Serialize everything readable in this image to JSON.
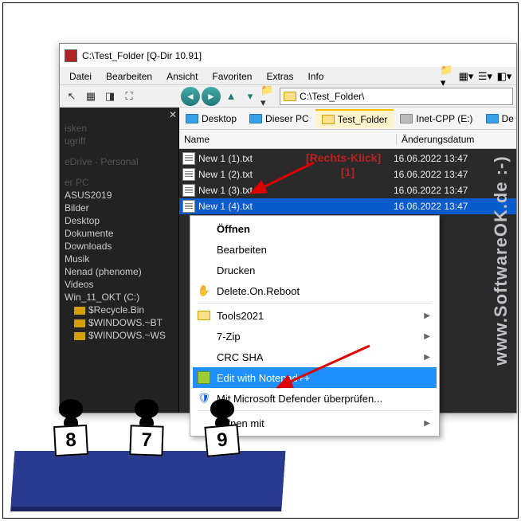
{
  "window": {
    "title": "C:\\Test_Folder  [Q-Dir 10.91]",
    "menu": [
      "Datei",
      "Bearbeiten",
      "Ansicht",
      "Favoriten",
      "Extras",
      "Info"
    ],
    "path": "C:\\Test_Folder\\"
  },
  "tree": {
    "dim": [
      "isken",
      "ugriff",
      "eDrive - Personal",
      "er PC"
    ],
    "items": [
      "ASUS2019",
      "Bilder",
      "Desktop",
      "Dokumente",
      "Downloads",
      "Musik",
      "Nenad (phenome)",
      "Videos",
      "Win_11_OKT (C:)"
    ],
    "sub": [
      "$Recycle.Bin",
      "$WINDOWS.~BT",
      "$WINDOWS.~WS"
    ]
  },
  "tabs": [
    {
      "label": "Desktop",
      "icon": "monitor"
    },
    {
      "label": "Dieser PC",
      "icon": "monitor"
    },
    {
      "label": "Test_Folder",
      "icon": "folder",
      "active": true
    },
    {
      "label": "Inet-CPP (E:)",
      "icon": "drive"
    },
    {
      "label": "De",
      "icon": "monitor"
    }
  ],
  "columns": {
    "name": "Name",
    "date": "Änderungsdatum"
  },
  "files": [
    {
      "name": "New 1 (1).txt",
      "date": "16.06.2022 13:47"
    },
    {
      "name": "New 1 (2).txt",
      "date": "16.06.2022 13:47"
    },
    {
      "name": "New 1 (3).txt",
      "date": "16.06.2022 13:47"
    },
    {
      "name": "New 1 (4).txt",
      "date": "16.06.2022 13:47",
      "selected": true
    }
  ],
  "annotation": {
    "line1": "[Rechts-Klick]",
    "line2": "[1]"
  },
  "contextmenu": [
    {
      "label": "Öffnen",
      "bold": true
    },
    {
      "label": "Bearbeiten"
    },
    {
      "label": "Drucken"
    },
    {
      "label": "Delete.On.Reboot",
      "icon": "hand"
    },
    {
      "sep": true
    },
    {
      "label": "Tools2021",
      "icon": "folder",
      "submenu": true
    },
    {
      "label": "7-Zip",
      "submenu": true
    },
    {
      "label": "CRC SHA",
      "submenu": true
    },
    {
      "label": "Edit with Notepad++",
      "icon": "npp",
      "selected": true
    },
    {
      "label": "Mit Microsoft Defender überprüfen...",
      "icon": "shield"
    },
    {
      "sep": true
    },
    {
      "label": "Öffnen mit",
      "submenu": true
    }
  ],
  "judges": [
    "8",
    "7",
    "9"
  ],
  "watermark": "www.SoftwareOK.de :-)"
}
